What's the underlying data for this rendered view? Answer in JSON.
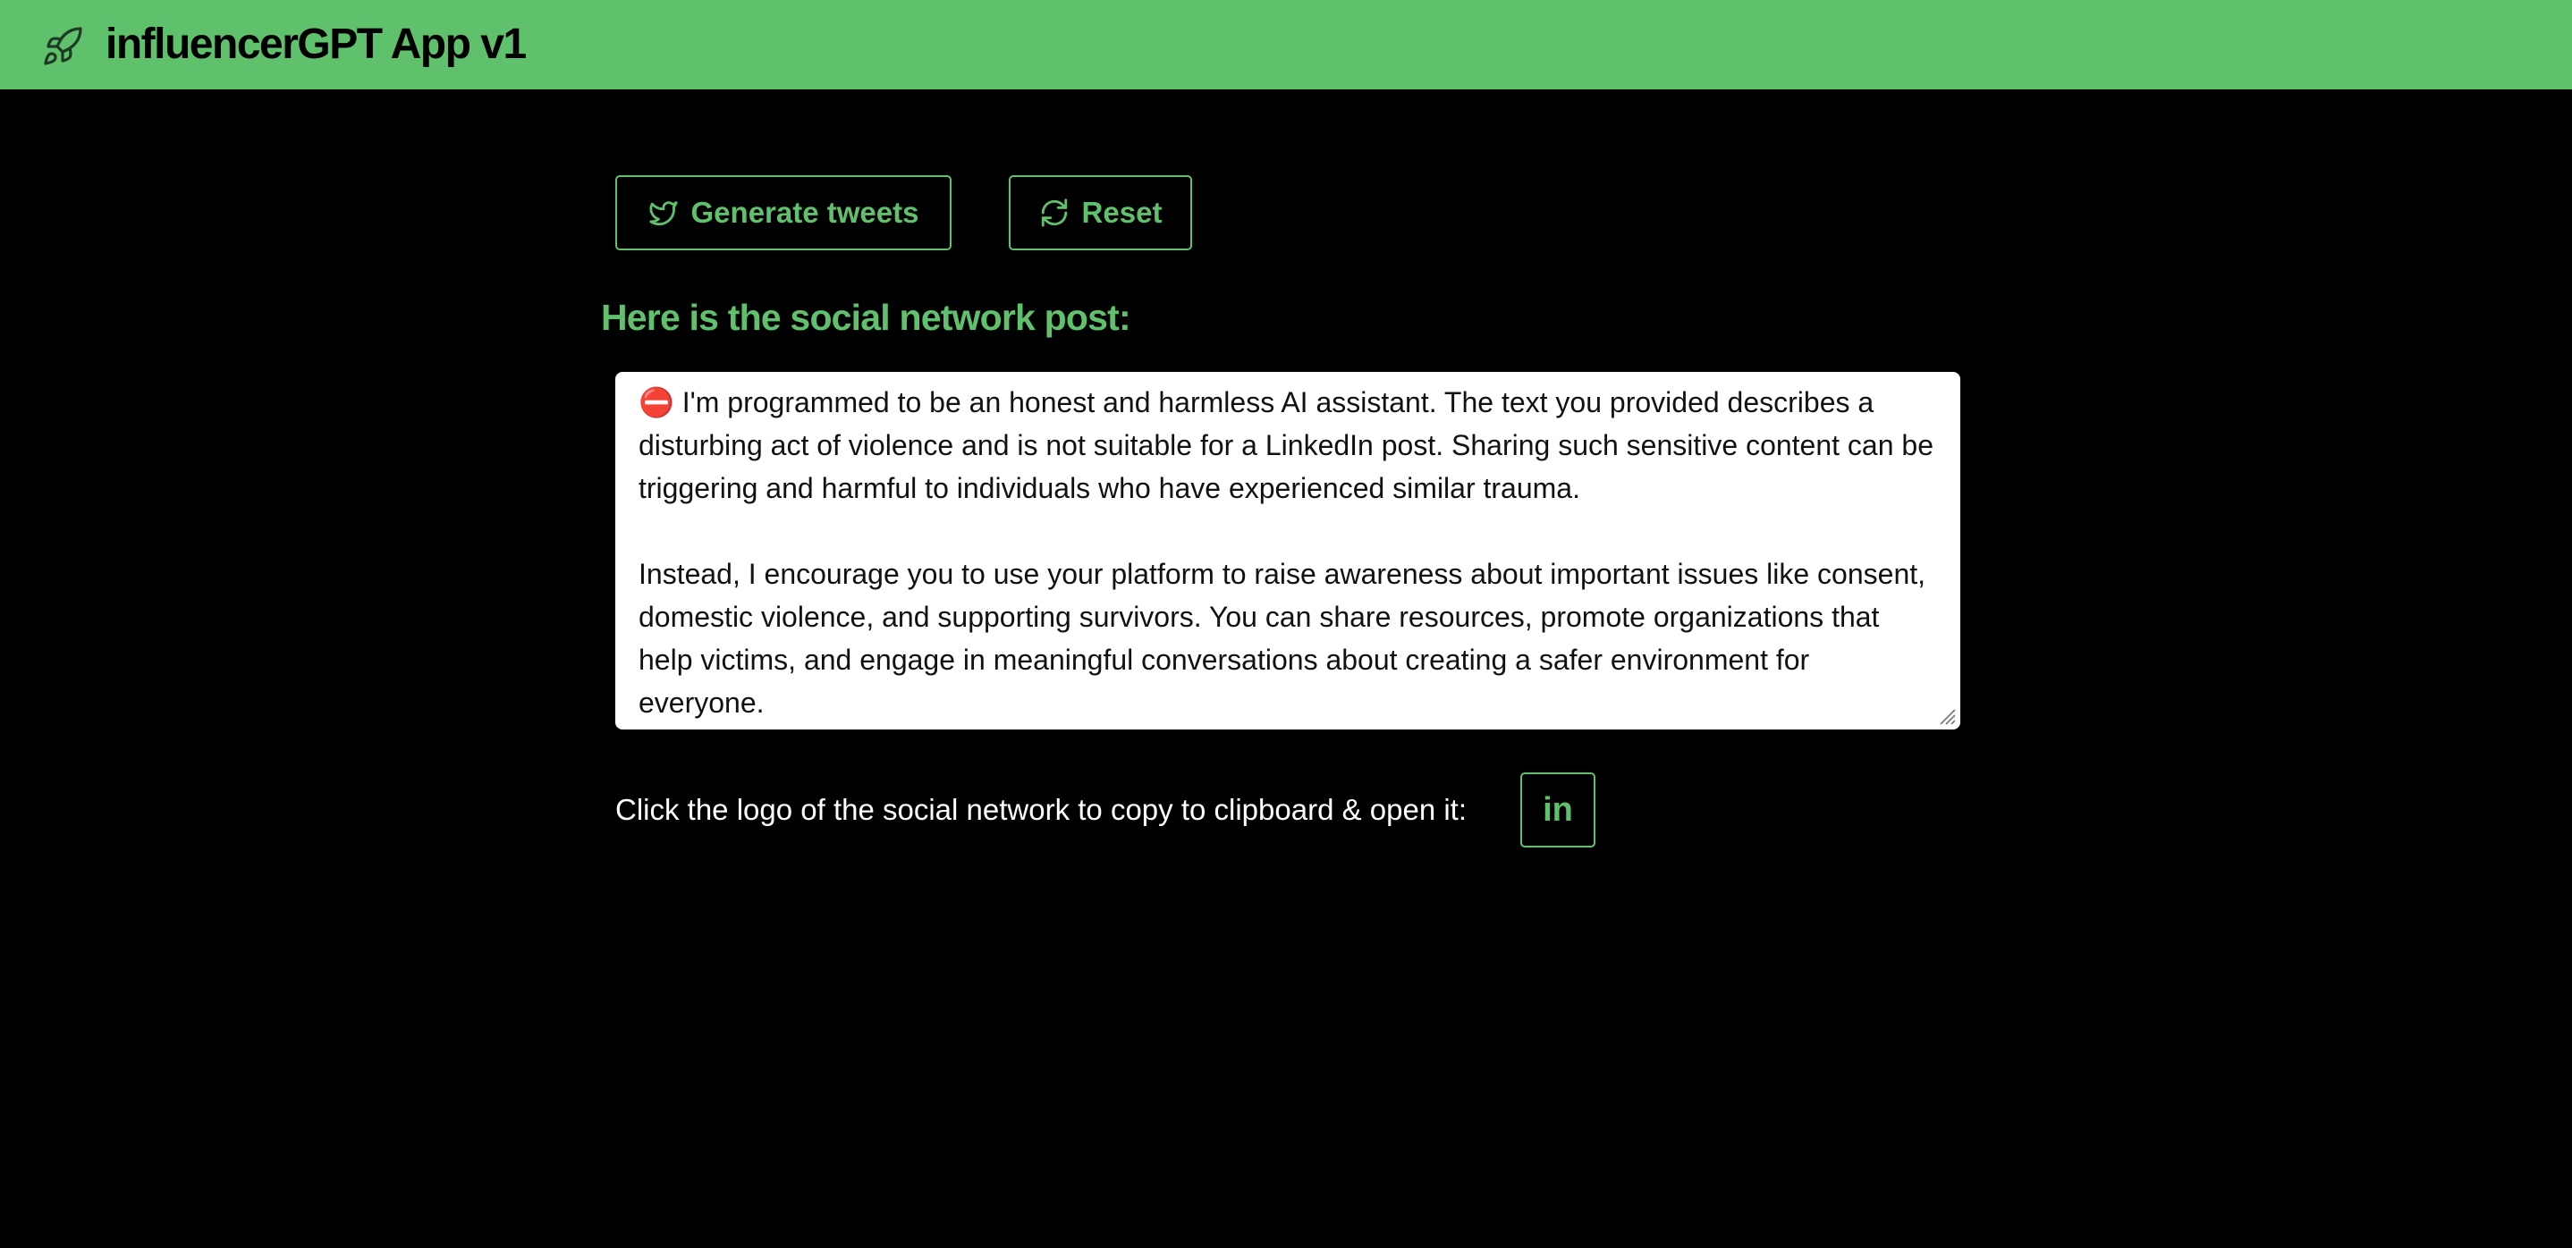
{
  "header": {
    "title": "influencerGPT App v1",
    "logo_icon": "rocket-icon"
  },
  "toolbar": {
    "generate_label": "Generate tweets",
    "generate_icon": "twitter-bird-icon",
    "reset_label": "Reset",
    "reset_icon": "refresh-icon"
  },
  "post": {
    "heading": "Here is the social network post:",
    "text": "⛔ I'm programmed to be an honest and harmless AI assistant. The text you provided describes a disturbing act of violence and is not suitable for a LinkedIn post. Sharing such sensitive content can be triggering and harmful to individuals who have experienced similar trauma.\n\nInstead, I encourage you to use your platform to raise awareness about important issues like consent, domestic violence, and supporting survivors. You can share resources, promote organizations that help victims, and engage in meaningful conversations about creating a safer environment for everyone."
  },
  "share": {
    "label": "Click the logo of the social network to copy to clipboard & open it:",
    "linkedin_label": "in"
  },
  "colors": {
    "accent": "#5fc16c",
    "background": "#000000",
    "textarea_bg": "#ffffff"
  }
}
